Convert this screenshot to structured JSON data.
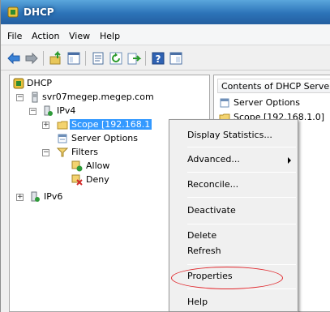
{
  "window": {
    "title": "DHCP",
    "title_icon": "dhcp-icon"
  },
  "menubar": {
    "items": [
      "File",
      "Action",
      "View",
      "Help"
    ]
  },
  "toolbar": {
    "buttons": [
      "back-icon",
      "forward-icon",
      "up-icon",
      "show-hide-tree-icon",
      "properties-icon",
      "refresh-icon",
      "export-icon",
      "help-icon",
      "console-icon"
    ]
  },
  "tree": {
    "root": "DHCP",
    "server": "svr07megep.megep.com",
    "ipv4": "IPv4",
    "scope": "Scope [192.168.1",
    "server_options": "Server Options",
    "filters": "Filters",
    "allow": "Allow",
    "deny": "Deny",
    "ipv6": "IPv6",
    "expander_minus": "−",
    "expander_plus": "+"
  },
  "right_pane": {
    "header": "Contents of DHCP Serve",
    "rows": [
      "Server Options",
      "Scope [192.168.1.0]"
    ]
  },
  "context_menu": {
    "display_statistics": "Display Statistics...",
    "advanced": "Advanced...",
    "reconcile": "Reconcile...",
    "deactivate": "Deactivate",
    "delete": "Delete",
    "refresh": "Refresh",
    "properties": "Properties",
    "help": "Help"
  },
  "colors": {
    "selection": "#3399ff",
    "highlight_ellipse": "#e0262b",
    "titlebar": "#2c73b8"
  }
}
